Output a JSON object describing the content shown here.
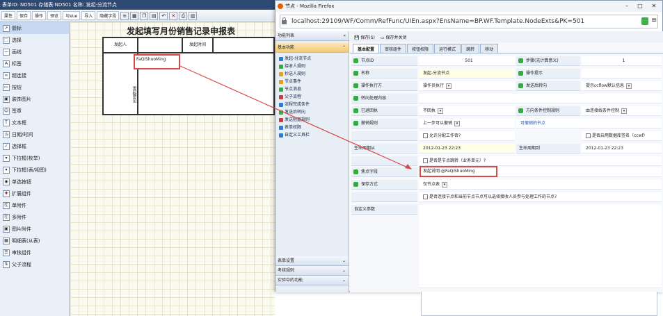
{
  "designer": {
    "title": "表单ID: ND501 存储表:ND501 名称: 发起-分流节点",
    "toolbar_buttons": [
      "属性",
      "保存",
      "操作",
      "预览",
      "与Vue",
      "导入",
      "隐藏字段"
    ],
    "tools": [
      {
        "label": "箭标",
        "icon": "arrow-icon",
        "selected": true
      },
      {
        "label": "选择",
        "icon": "select-icon"
      },
      {
        "label": "画线",
        "icon": "line-icon"
      },
      {
        "label": "标签",
        "icon": "label-icon"
      },
      {
        "label": "超连接",
        "icon": "link-icon"
      },
      {
        "label": "按钮",
        "icon": "button-icon"
      },
      {
        "label": "装饰图片",
        "icon": "image-icon"
      },
      {
        "label": "签章",
        "icon": "stamp-icon"
      },
      {
        "label": "文本框",
        "icon": "textbox-icon"
      },
      {
        "label": "日期/时间",
        "icon": "date-icon"
      },
      {
        "label": "选择框",
        "icon": "checkbox-icon"
      },
      {
        "label": "下拉框(枚举)",
        "icon": "dropdown-icon"
      },
      {
        "label": "下拉框(表/视图)",
        "icon": "dropdown-table-icon"
      },
      {
        "label": "单选按钮",
        "icon": "radio-icon"
      },
      {
        "label": "扩展组件",
        "icon": "extension-icon"
      },
      {
        "label": "单附件",
        "icon": "attachment-icon"
      },
      {
        "label": "多附件",
        "icon": "attachments-icon"
      },
      {
        "label": "图片附件",
        "icon": "image-attachment-icon"
      },
      {
        "label": "明细表(从表)",
        "icon": "detail-table-icon"
      },
      {
        "label": "审核组件",
        "icon": "audit-icon"
      },
      {
        "label": "父子流程",
        "icon": "subflow-icon"
      }
    ],
    "form_title": "发起填写月份销售记录申报表",
    "form_cells": {
      "initiator_label": "发起人",
      "time_label": "发起时间",
      "opinion_label": "发起意见",
      "field_value": "FaQiShuoMing"
    }
  },
  "popup": {
    "window_title": "节点 - Mozilla Firefox",
    "url": "localhost:29109/WF/Comm/RefFunc/UIEn.aspx?EnsName=BP.WF.Template.NodeExts&PK=501",
    "left_panel_title": "功能列表",
    "basic_section": "基本功能",
    "functions": [
      {
        "label": "发起-分流节点",
        "color": "#2e7bd6"
      },
      {
        "label": "接收人规则",
        "color": "#39a844"
      },
      {
        "label": "抄送人规则",
        "color": "#e0a020"
      },
      {
        "label": "节点事件",
        "color": "#e0a020"
      },
      {
        "label": "节点消息",
        "color": "#39a844"
      },
      {
        "label": "父子流程",
        "color": "#c04040"
      },
      {
        "label": "流程完成条件",
        "color": "#2e7bd6"
      },
      {
        "label": "发送后转向",
        "color": "#39a844"
      },
      {
        "label": "发送阻塞规则",
        "color": "#c04040"
      },
      {
        "label": "表单权限",
        "color": "#2e7bd6"
      },
      {
        "label": "自定义工具栏",
        "color": "#2e7bd6"
      }
    ],
    "bottom_sections": [
      "表单设置",
      "考核规则",
      "实验中的功能"
    ],
    "actions": {
      "save": "保存(S)",
      "save_close": "保存并关闭"
    },
    "tabs": [
      "基本配置",
      "审核组件",
      "按钮权限",
      "运行模式",
      "跳转",
      "移动"
    ],
    "fields": {
      "node_id_label": "节点ID",
      "node_id": "501",
      "step_label": "步骤(无计算意义)",
      "step": "1",
      "name_label": "名称",
      "name": "发起-分流节点",
      "tip_label": "操作提示",
      "execute_label": "操作执行方",
      "execute": "操作员执行",
      "send_label": "发送后转向",
      "send": "提示ccflow默认信息",
      "turn_label": "转向处理内容",
      "return_label": "已退回执",
      "return": "不回执",
      "cond_label": "方向条件控制规则",
      "cond": "由连接线条件控制",
      "cancel_label": "撤销规则",
      "cancel": "上一步可以撤销",
      "cancel_nodes_label": "可撤销的节点",
      "allow_assign": "允许分配工作否?",
      "plugin_checkbox": "是否启用数据库签名（ccwf）",
      "period_label": "生命周期从",
      "period": "2012-01-23 22:23",
      "period_to_label": "生命周期到",
      "period_to": "2012-01-23 22:23",
      "skip_checkbox": "是否是节点跳转（业务单元）?",
      "focus_label": "焦点字段",
      "focus": "发起说明:@FaQiShuoMing",
      "save_mode_label": "保存方式",
      "save_mode": "仅节点表",
      "recall_checkbox": "是否连接节点和当前节点节点可以选择接收人员参与处理工作的节点?",
      "custom_label": "自定义参数"
    }
  }
}
